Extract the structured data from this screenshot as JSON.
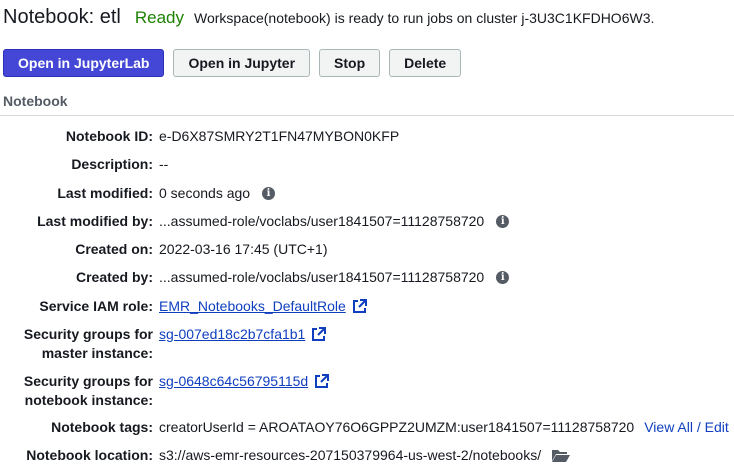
{
  "header": {
    "title": "Notebook: etl",
    "status": "Ready",
    "status_message": "Workspace(notebook) is ready to run jobs on cluster j-3U3C1KFDHO6W3."
  },
  "toolbar": {
    "open_jupyterlab": "Open in JupyterLab",
    "open_jupyter": "Open in Jupyter",
    "stop": "Stop",
    "delete": "Delete"
  },
  "section": {
    "title": "Notebook"
  },
  "details": {
    "notebook_id_label": "Notebook ID:",
    "notebook_id": "e-D6X87SMRY2T1FN47MYBON0KFP",
    "description_label": "Description:",
    "description": "--",
    "last_modified_label": "Last modified:",
    "last_modified": "0 seconds ago",
    "last_modified_by_label": "Last modified by:",
    "last_modified_by": "...assumed-role/voclabs/user1841507=11128758720",
    "created_on_label": "Created on:",
    "created_on": "2022-03-16 17:45 (UTC+1)",
    "created_by_label": "Created by:",
    "created_by": "...assumed-role/voclabs/user1841507=11128758720",
    "service_role_label": "Service IAM role:",
    "service_role": "EMR_Notebooks_DefaultRole",
    "sg_master_label_1": "Security groups for",
    "sg_master_label_2": "master instance:",
    "sg_master": "sg-007ed18c2b7cfa1b1",
    "sg_notebook_label_1": "Security groups for",
    "sg_notebook_label_2": "notebook instance:",
    "sg_notebook": "sg-0648c64c56795115d",
    "tags_label": "Notebook tags:",
    "tags": "creatorUserId = AROATAOY76O6GPPZ2UMZM:user1841507=11128758720",
    "view_all": "View All",
    "tag_separator": " / ",
    "edit": "Edit",
    "location_label": "Notebook location:",
    "location": "s3://aws-emr-resources-207150379964-us-west-2/notebooks/"
  },
  "colors": {
    "ready": "#1d8102",
    "primary_button": "#4447d6",
    "link": "#0f3fbf"
  },
  "icons": {
    "info": "info-icon",
    "external_link": "external-link-icon",
    "folder": "folder-open-icon"
  }
}
